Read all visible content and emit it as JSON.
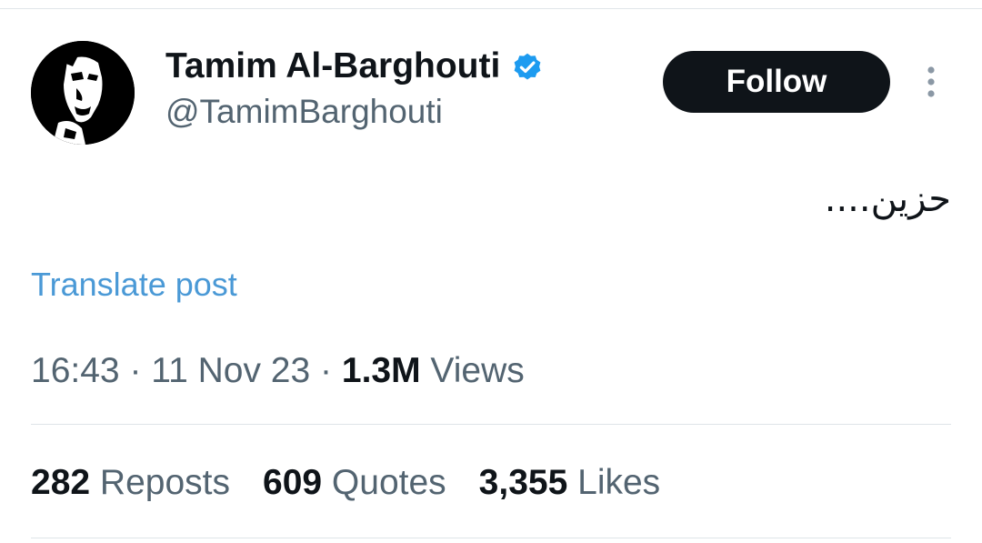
{
  "author": {
    "display_name": "Tamim Al-Barghouti",
    "handle": "@TamimBarghouti",
    "verified": true
  },
  "actions": {
    "follow_label": "Follow",
    "more_icon": "more-vertical-icon"
  },
  "post": {
    "text": "حزين....",
    "translate_label": "Translate post"
  },
  "meta": {
    "time": "16:43",
    "sep1": "·",
    "date": "11 Nov 23",
    "sep2": "·",
    "views_count": "1.3M",
    "views_label": "Views"
  },
  "stats": {
    "reposts_count": "282",
    "reposts_label": "Reposts",
    "quotes_count": "609",
    "quotes_label": "Quotes",
    "likes_count": "3,355",
    "likes_label": "Likes"
  },
  "colors": {
    "text_primary": "#0f1419",
    "text_secondary": "#536471",
    "link": "#4a99d6",
    "verified_badge": "#1d9bf0",
    "button_bg": "#0f1419",
    "button_text": "#ffffff"
  }
}
